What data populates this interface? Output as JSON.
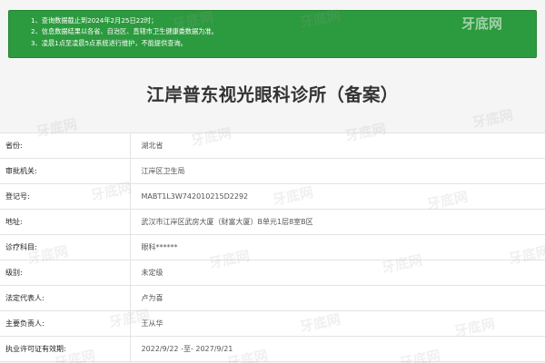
{
  "notice": {
    "items": [
      "1、查询数据截止到2024年2月25日22时；",
      "2、信息数据结果以各省、自治区、直辖市卫生健康委数据为准。",
      "3、凌晨1点至凌晨5点系统进行维护，不能提供查询。"
    ]
  },
  "watermark_text": "牙底网",
  "title": "江岸普东视光眼科诊所（备案）",
  "rows": [
    {
      "label": "省份:",
      "value": "湖北省"
    },
    {
      "label": "审批机关:",
      "value": "江岸区卫生局"
    },
    {
      "label": "登记号:",
      "value": "MABT1L3W742010215D2292"
    },
    {
      "label": "地址:",
      "value": "武汉市江岸区武房大厦（财富大厦）B单元1层8室B区"
    },
    {
      "label": "诊疗科目:",
      "value": "眼科******"
    },
    {
      "label": "级别:",
      "value": "未定级"
    },
    {
      "label": "法定代表人:",
      "value": "卢为喜"
    },
    {
      "label": "主要负责人:",
      "value": "王从华"
    },
    {
      "label": "执业许可证有效期:",
      "value": "2022/9/22 -至- 2027/9/21"
    }
  ]
}
